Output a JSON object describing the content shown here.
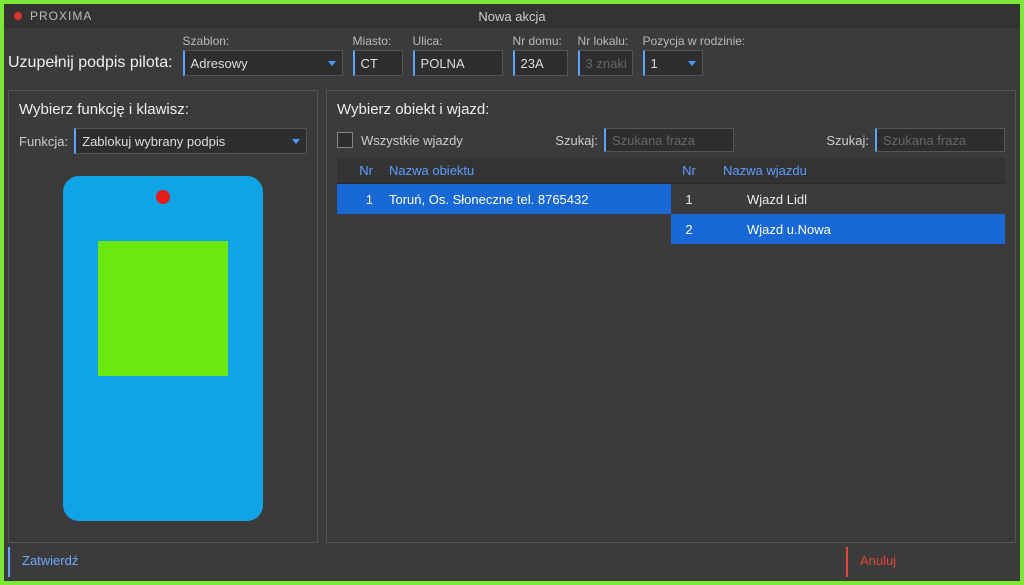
{
  "titlebar": {
    "app": "PROXIMA",
    "center": "Nowa akcja"
  },
  "topform": {
    "title": "Uzupełnij podpis pilota:",
    "szablon_label": "Szablon:",
    "szablon_value": "Adresowy",
    "miasto_label": "Miasto:",
    "miasto_value": "CT",
    "ulica_label": "Ulica:",
    "ulica_value": "POLNA",
    "nrdomu_label": "Nr domu:",
    "nrdomu_value": "23A",
    "nrlokalu_label": "Nr lokalu:",
    "nrlokalu_placeholder": "3 znaki",
    "pozycja_label": "Pozycja w rodzinie:",
    "pozycja_value": "1"
  },
  "left": {
    "title": "Wybierz funkcję i klawisz:",
    "funkcja_label": "Funkcja:",
    "funkcja_value": "Zablokuj wybrany podpis"
  },
  "right": {
    "title": "Wybierz obiekt i wjazd:",
    "checkbox_label": "Wszystkie wjazdy",
    "search_label": "Szukaj:",
    "search_placeholder": "Szukana fraza",
    "col_nr": "Nr",
    "col_obj": "Nazwa obiektu",
    "col_wjazd": "Nazwa wjazdu",
    "objects": [
      {
        "nr": "1",
        "name": "Toruń, Os. Słoneczne tel. 8765432"
      }
    ],
    "entries": [
      {
        "nr": "1",
        "name": "Wjazd Lidl",
        "sel": false
      },
      {
        "nr": "2",
        "name": "Wjazd u.Nowa",
        "sel": true
      }
    ]
  },
  "footer": {
    "ok": "Zatwierdź",
    "cancel": "Anuluj"
  }
}
